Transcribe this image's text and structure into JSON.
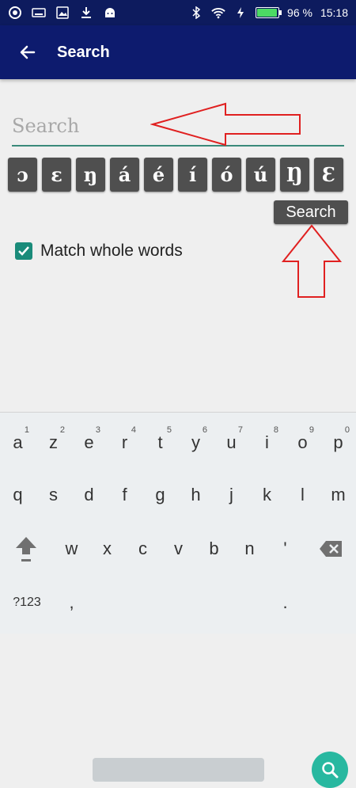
{
  "status": {
    "battery_percent": "96 %",
    "time": "15:18",
    "battery_level": 0.96
  },
  "appbar": {
    "title": "Search"
  },
  "search": {
    "placeholder": "Search",
    "button_label": "Search"
  },
  "special_chars": [
    "ɔ",
    "ɛ",
    "ŋ",
    "á",
    "é",
    "í",
    "ó",
    "ú",
    "Ŋ",
    "Ɛ"
  ],
  "options": {
    "match_whole_words": "Match whole words",
    "match_whole_words_checked": true
  },
  "keyboard": {
    "row1": [
      {
        "key": "a",
        "num": "1"
      },
      {
        "key": "z",
        "num": "2"
      },
      {
        "key": "e",
        "num": "3"
      },
      {
        "key": "r",
        "num": "4"
      },
      {
        "key": "t",
        "num": "5"
      },
      {
        "key": "y",
        "num": "6"
      },
      {
        "key": "u",
        "num": "7"
      },
      {
        "key": "i",
        "num": "8"
      },
      {
        "key": "o",
        "num": "9"
      },
      {
        "key": "p",
        "num": "0"
      }
    ],
    "row2": [
      "q",
      "s",
      "d",
      "f",
      "g",
      "h",
      "j",
      "k",
      "l",
      "m"
    ],
    "row3": [
      "w",
      "x",
      "c",
      "v",
      "b",
      "n",
      "'"
    ],
    "symbols_label": "?123",
    "comma": ",",
    "period": "."
  },
  "colors": {
    "statusbar": "#0d1b5e",
    "appbar": "#0d1b6e",
    "accent": "#1a8b7a",
    "enter_key": "#28b8a0",
    "annotation_arrow": "#e02020"
  }
}
